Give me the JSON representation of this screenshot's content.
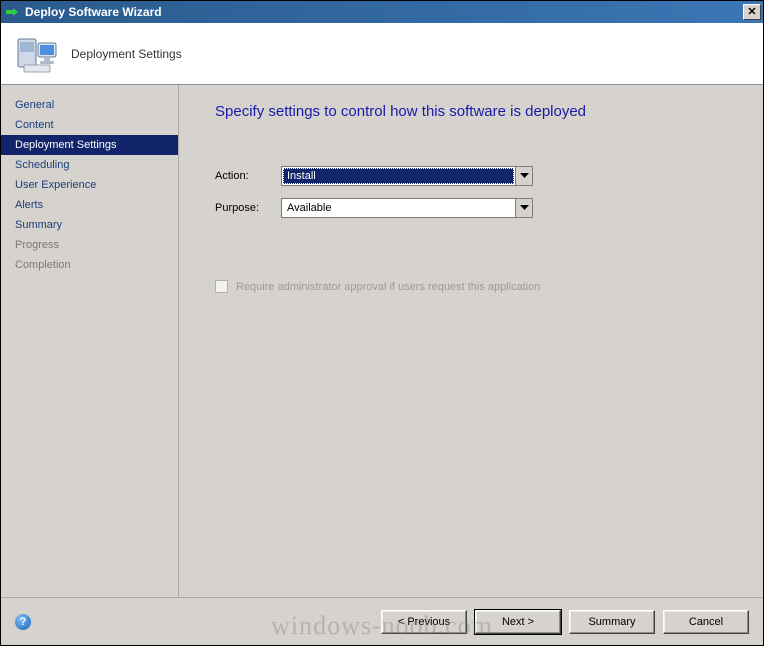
{
  "window": {
    "title": "Deploy Software Wizard",
    "close_glyph": "✕"
  },
  "header": {
    "subtitle": "Deployment Settings"
  },
  "sidebar": {
    "items": [
      {
        "label": "General",
        "state": "normal"
      },
      {
        "label": "Content",
        "state": "normal"
      },
      {
        "label": "Deployment Settings",
        "state": "selected"
      },
      {
        "label": "Scheduling",
        "state": "normal"
      },
      {
        "label": "User Experience",
        "state": "normal"
      },
      {
        "label": "Alerts",
        "state": "normal"
      },
      {
        "label": "Summary",
        "state": "normal"
      },
      {
        "label": "Progress",
        "state": "dim"
      },
      {
        "label": "Completion",
        "state": "dim"
      }
    ]
  },
  "page": {
    "heading": "Specify settings to control how this software is deployed",
    "action_label": "Action:",
    "action_value": "Install",
    "purpose_label": "Purpose:",
    "purpose_value": "Available",
    "require_approval_label": "Require administrator approval if users request this application",
    "require_approval_checked": false,
    "require_approval_enabled": false
  },
  "footer": {
    "help_glyph": "?",
    "previous": "< Previous",
    "next": "Next >",
    "summary": "Summary",
    "cancel": "Cancel"
  },
  "watermark": "windows-noob.com"
}
